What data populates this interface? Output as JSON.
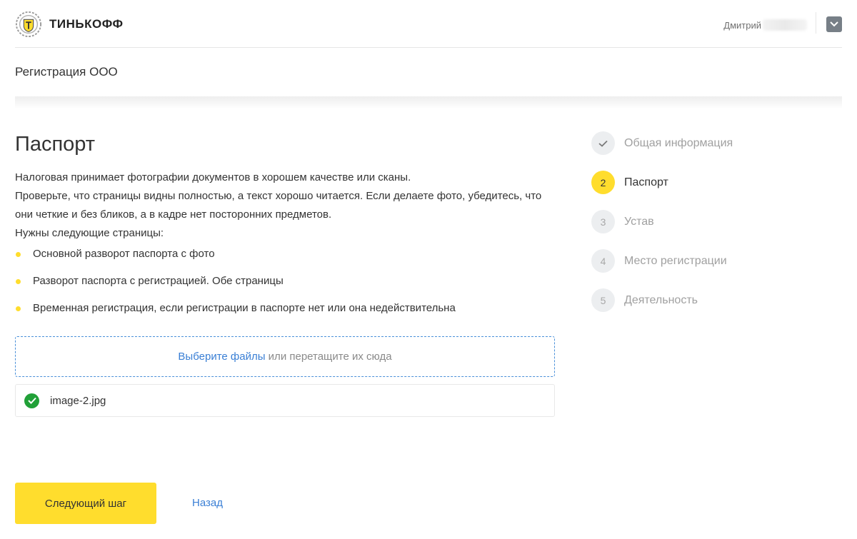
{
  "header": {
    "brand": "ТИНЬКОФФ",
    "user_name": "Дмитрий"
  },
  "subheader": {
    "title": "Регистрация ООО"
  },
  "main": {
    "title": "Паспорт",
    "intro_lines": [
      "Налоговая принимает фотографии документов в хорошем качестве или сканы.",
      "Проверьте, что страницы видны полностью, а текст хорошо читается. Если делаете фото, убедитесь, что они четкие и без бликов, а в кадре нет посторонних предметов.",
      "Нужны следующие страницы:"
    ],
    "requirements": [
      "Основной разворот паспорта с фото",
      "Разворот паспорта с регистрацией. Обе страницы",
      "Временная регистрация, если регистрации в паспорте нет или она недействительна"
    ]
  },
  "upload": {
    "choose_link": "Выберите файлы",
    "drop_hint": " или перетащите их сюда",
    "files": [
      {
        "name": "image-2.jpg",
        "status": "uploaded"
      }
    ]
  },
  "actions": {
    "next_label": "Следующий шаг",
    "back_label": "Назад"
  },
  "steps": [
    {
      "marker": "",
      "label": "Общая информация",
      "state": "done"
    },
    {
      "marker": "2",
      "label": "Паспорт",
      "state": "active"
    },
    {
      "marker": "3",
      "label": "Устав",
      "state": "pending"
    },
    {
      "marker": "4",
      "label": "Место регистрации",
      "state": "pending"
    },
    {
      "marker": "5",
      "label": "Деятельность",
      "state": "pending"
    }
  ],
  "colors": {
    "accent": "#ffdd2d",
    "link": "#3a7fd5",
    "success": "#21a038",
    "muted": "#a0a0a0"
  },
  "icons": {
    "logo": "tinkoff-emblem-icon",
    "user_menu": "chevron-down-icon",
    "file_status": "check-circle-icon",
    "step_done": "checkmark-icon"
  }
}
